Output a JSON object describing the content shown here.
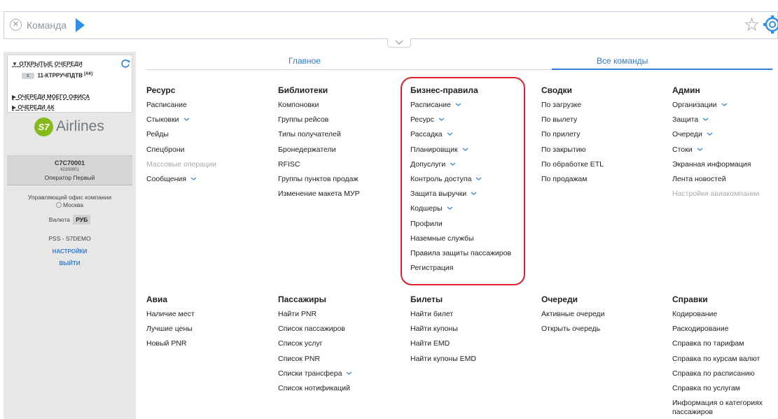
{
  "command_bar": {
    "placeholder": "Команда"
  },
  "left_panel": {
    "queues_header": "ОТКРЫТЫЕ ОЧЕРЕДИ",
    "queue_item": {
      "badge": "s",
      "name": "11-КТРРУЧПДТВ",
      "tag": "[АК]"
    },
    "links": [
      "ОЧЕРЕДИ МОЕГО ОФИСА",
      "ОЧЕРЕДИ АК"
    ],
    "logo": {
      "mark": "S7",
      "text": "Airlines"
    },
    "agent": {
      "code": "C7C70001",
      "number": "42100001",
      "role": "Оператор Первый"
    },
    "office": {
      "label": "Управляющий офис компании",
      "city": "Москва"
    },
    "currency": {
      "label": "Валюта",
      "value": "РУБ"
    },
    "system": "PSS - S7DEMO",
    "settings": "НАСТРОЙКИ",
    "logout": "ВЫЙТИ"
  },
  "tabs": {
    "main": "Главное",
    "all": "Все команды",
    "active": "all"
  },
  "columns_top": [
    {
      "title": "Ресурс",
      "items": [
        {
          "label": "Расписание",
          "submenu": false,
          "disabled": false
        },
        {
          "label": "Стыковки",
          "submenu": true,
          "disabled": false
        },
        {
          "label": "Рейды",
          "submenu": false,
          "disabled": false
        },
        {
          "label": "Спецброни",
          "submenu": false,
          "disabled": false
        },
        {
          "label": "Массовые операции",
          "submenu": false,
          "disabled": true
        },
        {
          "label": "Сообщения",
          "submenu": true,
          "disabled": false
        }
      ]
    },
    {
      "title": "Библиотеки",
      "items": [
        {
          "label": "Компоновки",
          "submenu": false,
          "disabled": false
        },
        {
          "label": "Группы рейсов",
          "submenu": false,
          "disabled": false
        },
        {
          "label": "Типы получателей",
          "submenu": false,
          "disabled": false
        },
        {
          "label": "Бронедержатели",
          "submenu": false,
          "disabled": false
        },
        {
          "label": "RFISC",
          "submenu": false,
          "disabled": false
        },
        {
          "label": "Группы пунктов продаж",
          "submenu": false,
          "disabled": false
        },
        {
          "label": "Изменение макета МУР",
          "submenu": false,
          "disabled": false
        }
      ]
    },
    {
      "title": "Бизнес-правила",
      "items": [
        {
          "label": "Расписание",
          "submenu": true,
          "disabled": false
        },
        {
          "label": "Ресурс",
          "submenu": true,
          "disabled": false
        },
        {
          "label": "Рассадка",
          "submenu": true,
          "disabled": false
        },
        {
          "label": "Планировщик",
          "submenu": true,
          "disabled": false
        },
        {
          "label": "Допуслуги",
          "submenu": true,
          "disabled": false
        },
        {
          "label": "Контроль доступа",
          "submenu": true,
          "disabled": false
        },
        {
          "label": "Защита выручки",
          "submenu": true,
          "disabled": false
        },
        {
          "label": "Кодшеры",
          "submenu": true,
          "disabled": false
        },
        {
          "label": "Профили",
          "submenu": false,
          "disabled": false
        },
        {
          "label": "Наземные службы",
          "submenu": false,
          "disabled": false
        },
        {
          "label": "Правила защиты пассажиров",
          "submenu": false,
          "disabled": false
        },
        {
          "label": "Регистрация",
          "submenu": false,
          "disabled": false
        }
      ]
    },
    {
      "title": "Сводки",
      "items": [
        {
          "label": "По загрузке",
          "submenu": false,
          "disabled": false
        },
        {
          "label": "По вылету",
          "submenu": false,
          "disabled": false
        },
        {
          "label": "По прилету",
          "submenu": false,
          "disabled": false
        },
        {
          "label": "По закрытию",
          "submenu": false,
          "disabled": false
        },
        {
          "label": "По обработке ETL",
          "submenu": false,
          "disabled": false
        },
        {
          "label": "По продажам",
          "submenu": false,
          "disabled": false
        }
      ]
    },
    {
      "title": "Админ",
      "items": [
        {
          "label": "Организации",
          "submenu": true,
          "disabled": false
        },
        {
          "label": "Защита",
          "submenu": true,
          "disabled": false
        },
        {
          "label": "Очереди",
          "submenu": true,
          "disabled": false
        },
        {
          "label": "Стоки",
          "submenu": true,
          "disabled": false
        },
        {
          "label": "Экранная информация",
          "submenu": false,
          "disabled": false
        },
        {
          "label": "Лента новостей",
          "submenu": false,
          "disabled": false
        },
        {
          "label": "Настройки авиакомпании",
          "submenu": false,
          "disabled": true
        }
      ]
    }
  ],
  "columns_bottom": [
    {
      "title": "Авиа",
      "items": [
        {
          "label": "Наличие мест",
          "submenu": false,
          "disabled": false
        },
        {
          "label": "Лучшие цены",
          "submenu": false,
          "disabled": false
        },
        {
          "label": "Новый PNR",
          "submenu": false,
          "disabled": false
        }
      ]
    },
    {
      "title": "Пассажиры",
      "items": [
        {
          "label": "Найти PNR",
          "submenu": false,
          "disabled": false
        },
        {
          "label": "Список пассажиров",
          "submenu": false,
          "disabled": false
        },
        {
          "label": "Список услуг",
          "submenu": false,
          "disabled": false
        },
        {
          "label": "Список PNR",
          "submenu": false,
          "disabled": false
        },
        {
          "label": "Списки трансфера",
          "submenu": true,
          "disabled": false
        },
        {
          "label": "Список нотификаций",
          "submenu": false,
          "disabled": false
        }
      ]
    },
    {
      "title": "Билеты",
      "items": [
        {
          "label": "Найти билет",
          "submenu": false,
          "disabled": false
        },
        {
          "label": "Найти купоны",
          "submenu": false,
          "disabled": false
        },
        {
          "label": "Найти EMD",
          "submenu": false,
          "disabled": false
        },
        {
          "label": "Найти купоны EMD",
          "submenu": false,
          "disabled": false
        }
      ]
    },
    {
      "title": "Очереди",
      "items": [
        {
          "label": "Активные очереди",
          "submenu": false,
          "disabled": false
        },
        {
          "label": "Открыть очередь",
          "submenu": false,
          "disabled": false
        }
      ]
    },
    {
      "title": "Справки",
      "items": [
        {
          "label": "Кодирование",
          "submenu": false,
          "disabled": false
        },
        {
          "label": "Раскодирование",
          "submenu": false,
          "disabled": false
        },
        {
          "label": "Справка по тарифам",
          "submenu": false,
          "disabled": false
        },
        {
          "label": "Справка по курсам валют",
          "submenu": false,
          "disabled": false
        },
        {
          "label": "Справка по расписанию",
          "submenu": false,
          "disabled": false
        },
        {
          "label": "Справка по услугам",
          "submenu": false,
          "disabled": false
        },
        {
          "label": "Информация о категориях",
          "submenu": false,
          "disabled": false
        },
        {
          "label": "пассажиров",
          "submenu": false,
          "disabled": false
        }
      ]
    }
  ],
  "colors": {
    "accent": "#2f80d0",
    "highlight": "#e0202a",
    "disabled": "#aaaaaa",
    "brand": "#86b91a"
  }
}
